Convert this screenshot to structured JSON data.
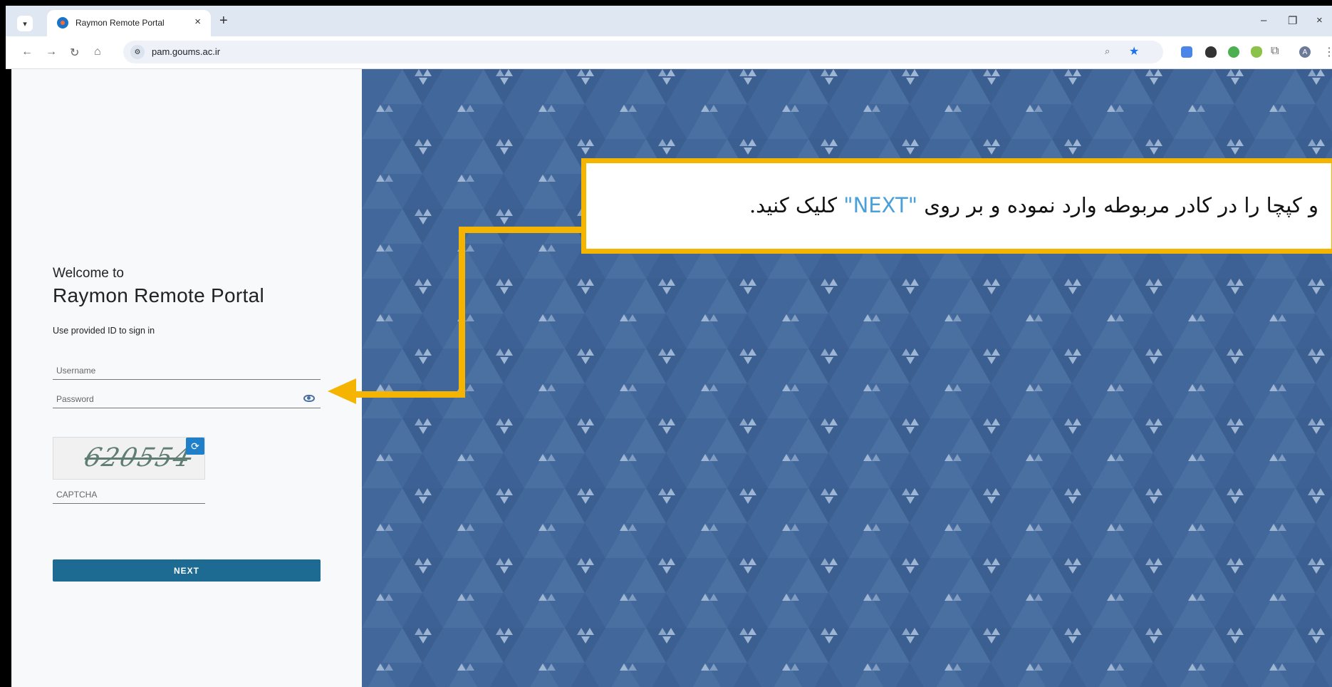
{
  "browser": {
    "tab_title": "Raymon Remote Portal",
    "tab_close": "×",
    "new_tab": "+",
    "url": "pam.goums.ac.ir",
    "window_controls": [
      "–",
      "❐",
      "×"
    ],
    "nav_icons": [
      "back-icon",
      "forward-icon",
      "reload-icon",
      "home-icon"
    ],
    "profile_initial": "A"
  },
  "login": {
    "welcome": "Welcome to",
    "portal_name": "Raymon Remote Portal",
    "hint": "Use provided ID to sign in",
    "username_placeholder": "Username",
    "password_placeholder": "Password",
    "captcha_image_text": "620554",
    "captcha_placeholder": "CAPTCHA",
    "next_label": "NEXT"
  },
  "annotation": {
    "text_before": "و کپچا را در کادر مربوطه وارد نموده و بر روی ",
    "highlight": "\"NEXT\"",
    "text_after": " کلیک کنید."
  },
  "colors": {
    "accent": "#f5b400",
    "button": "#1d6a93",
    "background": "#42679a",
    "highlight": "#4aa0d8"
  }
}
